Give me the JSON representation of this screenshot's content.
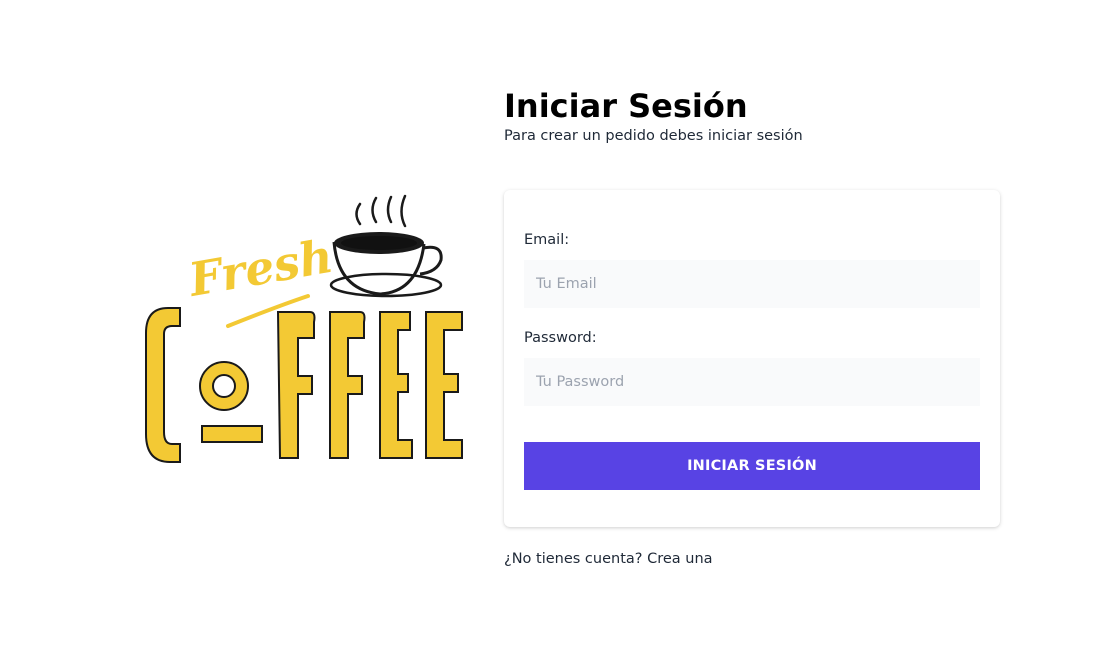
{
  "logo": {
    "script_text": "Fresh",
    "main_text": "COFFEE",
    "colors": {
      "yellow": "#f3c934",
      "outline": "#1a1a1a"
    }
  },
  "header": {
    "title": "Iniciar Sesión",
    "subtitle": "Para crear un pedido debes iniciar sesión"
  },
  "form": {
    "email": {
      "label": "Email:",
      "placeholder": "Tu Email",
      "value": ""
    },
    "password": {
      "label": "Password:",
      "placeholder": "Tu Password",
      "value": ""
    },
    "submit_label": "INICIAR SESIÓN"
  },
  "footer": {
    "register_text": "¿No tienes cuenta? Crea una"
  },
  "colors": {
    "accent": "#5843e4",
    "input_bg": "#f9fafb",
    "placeholder": "#9ca3af"
  }
}
